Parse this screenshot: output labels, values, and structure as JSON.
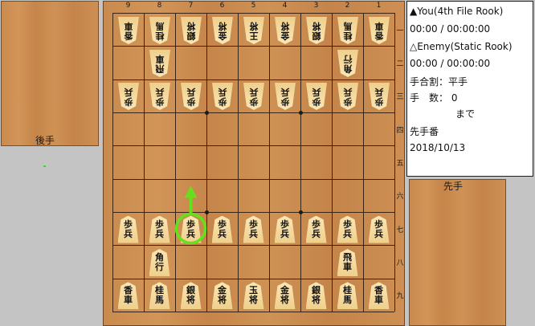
{
  "players": {
    "sente_name": "▲You(4th File Rook)",
    "sente_time": "00:00 / 00:00:00",
    "gote_name": "△Enemy(Static Rook)",
    "gote_time": "00:00 / 00:00:00"
  },
  "game_info": {
    "handicap": "手合割：平手",
    "move_count": "手　数：  0",
    "status": "まで",
    "turn": "先手番",
    "date": "2018/10/13"
  },
  "hands": {
    "gote_label": "後手",
    "sente_label": "先手"
  },
  "board": {
    "files": [
      "9",
      "8",
      "7",
      "6",
      "5",
      "4",
      "3",
      "2",
      "1"
    ],
    "ranks": [
      "一",
      "二",
      "三",
      "四",
      "五",
      "六",
      "七",
      "八",
      "九"
    ],
    "pieces": [
      {
        "file": 9,
        "rank": 1,
        "owner": "gote",
        "text": "香車"
      },
      {
        "file": 8,
        "rank": 1,
        "owner": "gote",
        "text": "桂馬"
      },
      {
        "file": 7,
        "rank": 1,
        "owner": "gote",
        "text": "銀将"
      },
      {
        "file": 6,
        "rank": 1,
        "owner": "gote",
        "text": "金将"
      },
      {
        "file": 5,
        "rank": 1,
        "owner": "gote",
        "text": "王将"
      },
      {
        "file": 4,
        "rank": 1,
        "owner": "gote",
        "text": "金将"
      },
      {
        "file": 3,
        "rank": 1,
        "owner": "gote",
        "text": "銀将"
      },
      {
        "file": 2,
        "rank": 1,
        "owner": "gote",
        "text": "桂馬"
      },
      {
        "file": 1,
        "rank": 1,
        "owner": "gote",
        "text": "香車"
      },
      {
        "file": 8,
        "rank": 2,
        "owner": "gote",
        "text": "飛車"
      },
      {
        "file": 2,
        "rank": 2,
        "owner": "gote",
        "text": "角行"
      },
      {
        "file": 9,
        "rank": 3,
        "owner": "gote",
        "text": "歩兵"
      },
      {
        "file": 8,
        "rank": 3,
        "owner": "gote",
        "text": "歩兵"
      },
      {
        "file": 7,
        "rank": 3,
        "owner": "gote",
        "text": "歩兵"
      },
      {
        "file": 6,
        "rank": 3,
        "owner": "gote",
        "text": "歩兵"
      },
      {
        "file": 5,
        "rank": 3,
        "owner": "gote",
        "text": "歩兵"
      },
      {
        "file": 4,
        "rank": 3,
        "owner": "gote",
        "text": "歩兵"
      },
      {
        "file": 3,
        "rank": 3,
        "owner": "gote",
        "text": "歩兵"
      },
      {
        "file": 2,
        "rank": 3,
        "owner": "gote",
        "text": "歩兵"
      },
      {
        "file": 1,
        "rank": 3,
        "owner": "gote",
        "text": "歩兵"
      },
      {
        "file": 9,
        "rank": 7,
        "owner": "sente",
        "text": "歩兵"
      },
      {
        "file": 8,
        "rank": 7,
        "owner": "sente",
        "text": "歩兵"
      },
      {
        "file": 7,
        "rank": 7,
        "owner": "sente",
        "text": "歩兵"
      },
      {
        "file": 6,
        "rank": 7,
        "owner": "sente",
        "text": "歩兵"
      },
      {
        "file": 5,
        "rank": 7,
        "owner": "sente",
        "text": "歩兵"
      },
      {
        "file": 4,
        "rank": 7,
        "owner": "sente",
        "text": "歩兵"
      },
      {
        "file": 3,
        "rank": 7,
        "owner": "sente",
        "text": "歩兵"
      },
      {
        "file": 2,
        "rank": 7,
        "owner": "sente",
        "text": "歩兵"
      },
      {
        "file": 1,
        "rank": 7,
        "owner": "sente",
        "text": "歩兵"
      },
      {
        "file": 8,
        "rank": 8,
        "owner": "sente",
        "text": "角行"
      },
      {
        "file": 2,
        "rank": 8,
        "owner": "sente",
        "text": "飛車"
      },
      {
        "file": 9,
        "rank": 9,
        "owner": "sente",
        "text": "香車"
      },
      {
        "file": 8,
        "rank": 9,
        "owner": "sente",
        "text": "桂馬"
      },
      {
        "file": 7,
        "rank": 9,
        "owner": "sente",
        "text": "銀将"
      },
      {
        "file": 6,
        "rank": 9,
        "owner": "sente",
        "text": "金将"
      },
      {
        "file": 5,
        "rank": 9,
        "owner": "sente",
        "text": "玉将"
      },
      {
        "file": 4,
        "rank": 9,
        "owner": "sente",
        "text": "金将"
      },
      {
        "file": 3,
        "rank": 9,
        "owner": "sente",
        "text": "銀将"
      },
      {
        "file": 2,
        "rank": 9,
        "owner": "sente",
        "text": "桂馬"
      },
      {
        "file": 1,
        "rank": 9,
        "owner": "sente",
        "text": "香車"
      }
    ],
    "highlight": {
      "file": 7,
      "rank": 7,
      "to_file": 7,
      "to_rank": 6,
      "color": "#66e01c"
    }
  },
  "colors": {
    "grid_line": "#3a2410",
    "info_bg": "#ffffff"
  }
}
